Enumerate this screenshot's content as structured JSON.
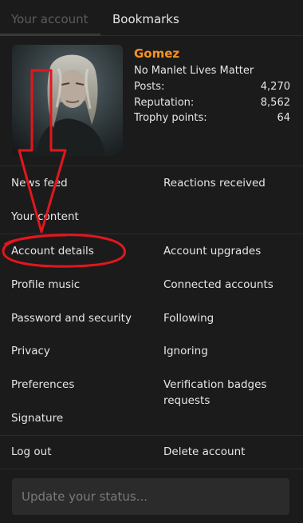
{
  "tabs": [
    {
      "label": "Your account"
    },
    {
      "label": "Bookmarks"
    }
  ],
  "profile": {
    "username": "Gomez",
    "title": "No Manlet Lives Matter",
    "stats": [
      {
        "label": "Posts:",
        "value": "4,270"
      },
      {
        "label": "Reputation:",
        "value": "8,562"
      },
      {
        "label": "Trophy points:",
        "value": "64"
      }
    ]
  },
  "menu": {
    "news_feed": "News feed",
    "reactions_received": "Reactions received",
    "your_content": "Your content",
    "account_details": "Account details",
    "account_upgrades": "Account upgrades",
    "profile_music": "Profile music",
    "connected_accounts": "Connected accounts",
    "password_security": "Password and security",
    "following": "Following",
    "privacy": "Privacy",
    "ignoring": "Ignoring",
    "preferences": "Preferences",
    "verification_badges": "Verification badges requests",
    "signature": "Signature",
    "log_out": "Log out",
    "delete_account": "Delete account"
  },
  "status": {
    "placeholder": "Update your status..."
  },
  "colors": {
    "background": "#1b1b1b",
    "username": "#f7931e",
    "annotation": "#e3161d"
  }
}
